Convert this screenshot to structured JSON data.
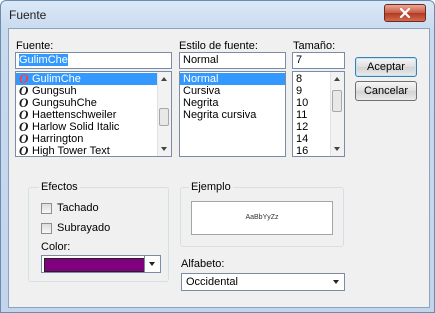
{
  "window": {
    "title": "Fuente"
  },
  "font": {
    "label": "Fuente:",
    "value": "GulimChe",
    "items": [
      {
        "name": "GulimChe",
        "selected": true
      },
      {
        "name": "Gungsuh",
        "selected": false
      },
      {
        "name": "GungsuhChe",
        "selected": false
      },
      {
        "name": "Haettenschweiler",
        "selected": false
      },
      {
        "name": "Harlow Solid Italic",
        "selected": false
      },
      {
        "name": "Harrington",
        "selected": false
      },
      {
        "name": "High Tower Text",
        "selected": false
      }
    ]
  },
  "style": {
    "label": "Estilo de fuente:",
    "value": "Normal",
    "items": [
      "Normal",
      "Cursiva",
      "Negrita",
      "Negrita cursiva"
    ]
  },
  "size": {
    "label": "Tamaño:",
    "value": "7",
    "items": [
      "8",
      "9",
      "10",
      "11",
      "12",
      "14",
      "16"
    ]
  },
  "buttons": {
    "ok": "Aceptar",
    "cancel": "Cancelar"
  },
  "effects": {
    "label": "Efectos",
    "strikeout": "Tachado",
    "underline": "Subrayado",
    "color_label": "Color:",
    "color": "#800080"
  },
  "sample": {
    "label": "Ejemplo",
    "text": "AaBbYyZz"
  },
  "script": {
    "label": "Alfabeto:",
    "value": "Occidental"
  }
}
